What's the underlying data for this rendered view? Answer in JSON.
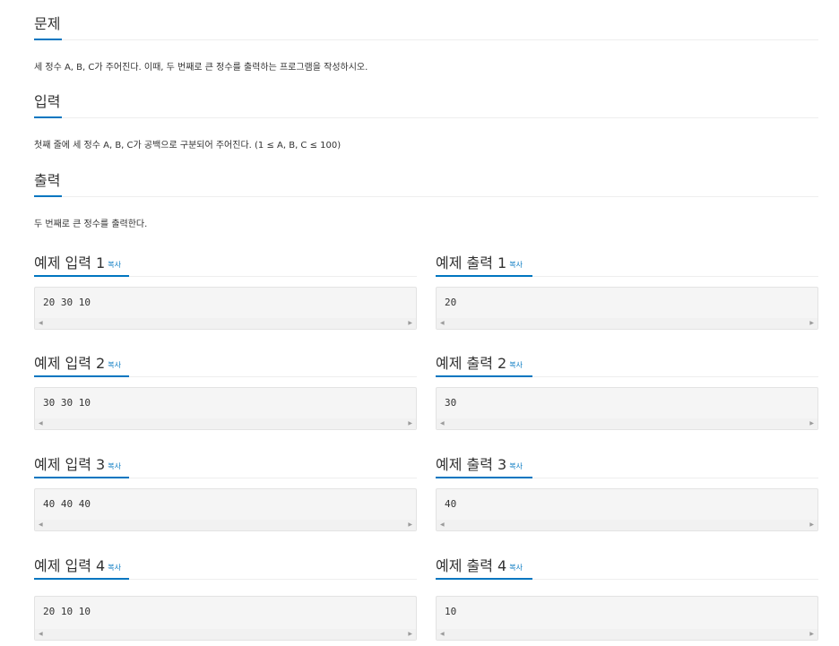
{
  "problem": {
    "title": "문제",
    "text": "세 정수 A, B, C가 주어진다. 이때, 두 번째로 큰 정수를 출력하는 프로그램을 작성하시오."
  },
  "input": {
    "title": "입력",
    "text": "첫째 줄에 세 정수 A, B, C가 공백으로 구분되어 주어진다. (1 ≤ A, B, C ≤ 100)"
  },
  "output": {
    "title": "출력",
    "text": "두 번째로 큰 정수를 출력한다."
  },
  "copy_label": "복사",
  "samples": [
    {
      "input_title": "예제 입력 1",
      "input_value": "20 30 10",
      "output_title": "예제 출력 1",
      "output_value": "20"
    },
    {
      "input_title": "예제 입력 2",
      "input_value": "30 30 10",
      "output_title": "예제 출력 2",
      "output_value": "30"
    },
    {
      "input_title": "예제 입력 3",
      "input_value": "40 40 40",
      "output_title": "예제 출력 3",
      "output_value": "40"
    },
    {
      "input_title": "예제 입력 4",
      "input_value": "20 10 10",
      "output_title": "예제 출력 4",
      "output_value": "10"
    }
  ],
  "colors": {
    "accent": "#0076c0",
    "code_background": "#f5f5f5"
  },
  "icons": {
    "scroll_left": "scroll-left-arrow-icon",
    "scroll_right": "scroll-right-arrow-icon"
  }
}
